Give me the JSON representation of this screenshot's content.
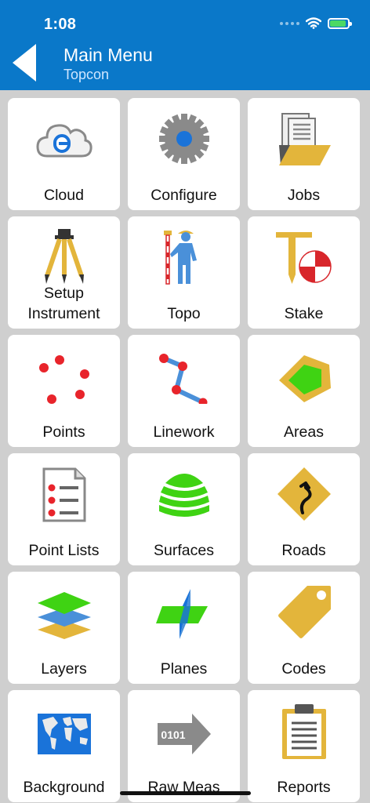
{
  "status": {
    "time": "1:08"
  },
  "header": {
    "title": "Main Menu",
    "subtitle": "Topcon"
  },
  "tiles": [
    {
      "label": "Cloud"
    },
    {
      "label": "Configure"
    },
    {
      "label": "Jobs"
    },
    {
      "label": "Setup Instrument"
    },
    {
      "label": "Topo"
    },
    {
      "label": "Stake"
    },
    {
      "label": "Points"
    },
    {
      "label": "Linework"
    },
    {
      "label": "Areas"
    },
    {
      "label": "Point Lists"
    },
    {
      "label": "Surfaces"
    },
    {
      "label": "Roads"
    },
    {
      "label": "Layers"
    },
    {
      "label": "Planes"
    },
    {
      "label": "Codes"
    },
    {
      "label": "Background"
    },
    {
      "label": "Raw Meas",
      "icon_text": "0101"
    },
    {
      "label": "Reports"
    }
  ]
}
